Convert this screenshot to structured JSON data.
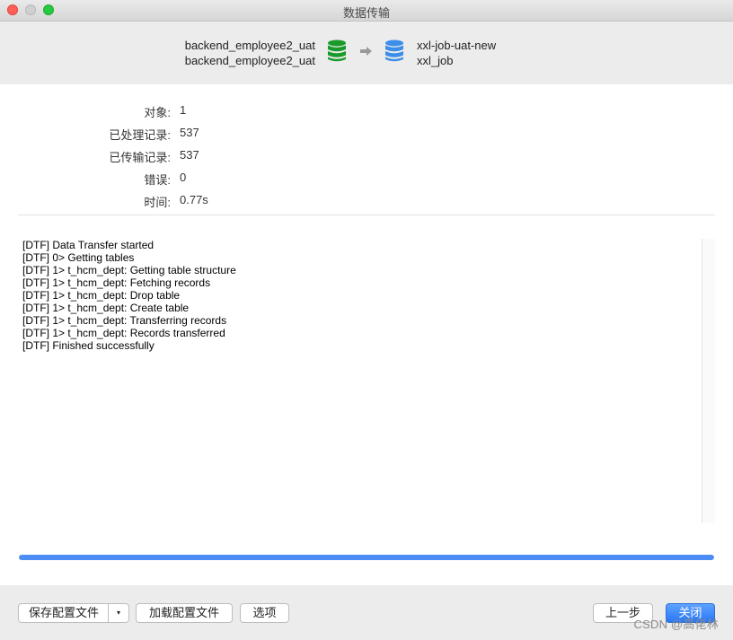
{
  "window": {
    "title": "数据传输"
  },
  "header": {
    "source": {
      "connection": "backend_employee2_uat",
      "database": "backend_employee2_uat",
      "icon": "database-icon",
      "color": "#1a9a2a"
    },
    "target": {
      "connection": "xxl-job-uat-new",
      "database": "xxl_job",
      "icon": "database-icon",
      "color": "#3d8ee8"
    },
    "arrow_icon": "arrow-right-icon"
  },
  "stats": [
    {
      "label": "对象:",
      "value": "1"
    },
    {
      "label": "已处理记录:",
      "value": "537"
    },
    {
      "label": "已传输记录:",
      "value": "537"
    },
    {
      "label": "错误:",
      "value": "0"
    },
    {
      "label": "时间:",
      "value": "0.77s"
    }
  ],
  "log": [
    "[DTF] Data Transfer started",
    "[DTF] 0> Getting tables",
    "[DTF] 1> t_hcm_dept: Getting table structure",
    "[DTF] 1> t_hcm_dept: Fetching records",
    "[DTF] 1> t_hcm_dept: Drop table",
    "[DTF] 1> t_hcm_dept: Create table",
    "[DTF] 1> t_hcm_dept: Transferring records",
    "[DTF] 1> t_hcm_dept: Records transferred",
    "[DTF] Finished successfully"
  ],
  "progress": {
    "percent": 100,
    "color": "#4b8df5"
  },
  "footer": {
    "save_profile": "保存配置文件",
    "load_profile": "加载配置文件",
    "options": "选项",
    "back": "上一步",
    "close": "关闭"
  },
  "watermark": "CSDN @高佬林"
}
